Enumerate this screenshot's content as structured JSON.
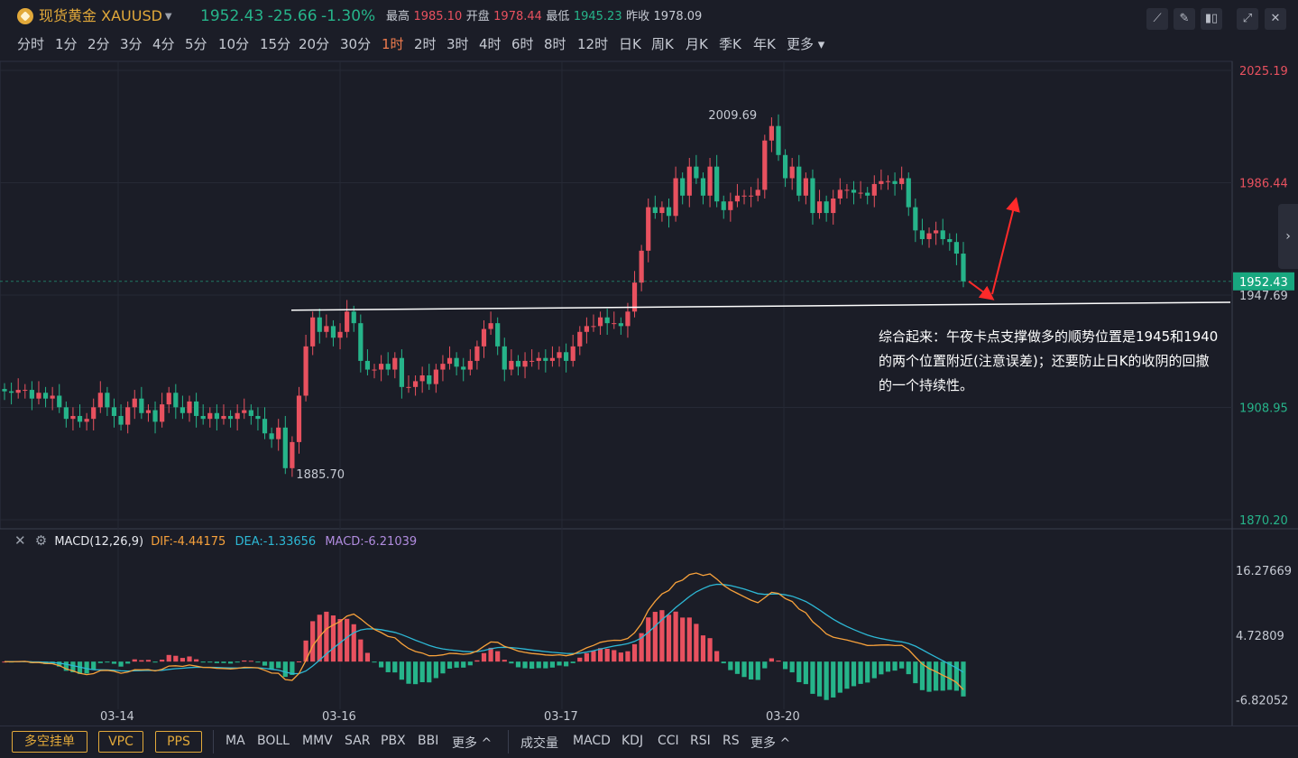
{
  "header": {
    "name": "现货黄金",
    "symbol": "XAUUSD",
    "price": "1952.43",
    "change": "-25.66",
    "change_pct": "-1.30%",
    "high_label": "最高",
    "high": "1985.10",
    "open_label": "开盘",
    "open": "1978.44",
    "low_label": "最低",
    "low": "1945.23",
    "prev_label": "昨收",
    "prev": "1978.09",
    "tools": [
      "line-tool-icon",
      "draw-pen-icon",
      "candle-style-icon",
      "fullscreen-icon",
      "close-icon"
    ]
  },
  "timeframes": [
    "分时",
    "1分",
    "2分",
    "3分",
    "4分",
    "5分",
    "10分",
    "15分",
    "20分",
    "30分",
    "1时",
    "2时",
    "3时",
    "4时",
    "6时",
    "8时",
    "12时",
    "日K",
    "周K",
    "月K",
    "季K",
    "年K",
    "更多"
  ],
  "active_timeframe": "1时",
  "colors": {
    "up": "#e8515f",
    "down": "#26b48a",
    "accent": "#e2a93a",
    "dif": "#f7a13b",
    "dea": "#2db8d5",
    "macd": "#b18cdf"
  },
  "chart_data": [
    {
      "type": "candlestick",
      "y_axis_labels": [
        "2025.19",
        "1986.44",
        "1947.69",
        "1908.95",
        "1870.20"
      ],
      "ylim": [
        1870.2,
        2025.19
      ],
      "x_axis_labels": [
        "03-14",
        "03-16",
        "03-17",
        "03-20"
      ],
      "last_price": "1952.43",
      "max_label": "2009.69",
      "min_label": "1885.70",
      "support_line": [
        1942.5,
        1945.2
      ],
      "grid": true,
      "closes": [
        1914.5,
        1914,
        1915,
        1915,
        1912,
        1914,
        1912,
        1913,
        1909,
        1905,
        1906,
        1904,
        1905,
        1909,
        1914,
        1909,
        1906,
        1903,
        1909,
        1912,
        1907,
        1908,
        1904,
        1910,
        1914,
        1909,
        1907,
        1911,
        1906,
        1905,
        1907,
        1905,
        1906,
        1905,
        1907,
        1908,
        1906,
        1905,
        1900,
        1898,
        1902,
        1888,
        1897,
        1913,
        1930,
        1940,
        1935,
        1937,
        1933,
        1935,
        1942,
        1938,
        1925,
        1922,
        1922,
        1924,
        1922,
        1926,
        1916,
        1916,
        1918,
        1920,
        1917,
        1922,
        1924,
        1926,
        1923,
        1922,
        1925,
        1930,
        1936,
        1938,
        1930,
        1922,
        1925,
        1923,
        1925,
        1925,
        1926,
        1925,
        1926,
        1928,
        1925,
        1930,
        1935,
        1937,
        1937,
        1940,
        1938,
        1938,
        1937,
        1942,
        1952,
        1963,
        1978,
        1976,
        1978,
        1975,
        1988,
        1982,
        1992,
        1988,
        1982,
        1992,
        1980,
        1977,
        1980,
        1982,
        1982,
        1982,
        1984,
        2001,
        2006,
        1996,
        1988,
        1992,
        1982,
        1988,
        1976,
        1980,
        1976,
        1981,
        1984,
        1984,
        1983,
        1983,
        1982,
        1986,
        1987,
        1987,
        1986,
        1988,
        1978,
        1970,
        1967,
        1969,
        1970,
        1967,
        1966,
        1962,
        1952.43
      ],
      "annotation_text": "综合起来：午夜卡点支撑做多的顺势位置是1945和1940的两个位置附近(注意误差)；还要防止日K的收阴的回撤的一个持续性。"
    },
    {
      "type": "macd",
      "title": "MACD(12,26,9)",
      "dif_label": "DIF:-4.44175",
      "dea_label": "DEA:-1.33656",
      "macd_label": "MACD:-6.21039",
      "y_axis_labels": [
        "16.27669",
        "4.72809",
        "-6.82052"
      ],
      "ylim": [
        -8.5,
        19.5
      ],
      "x_axis_labels": [
        "03-14",
        "03-16",
        "03-17",
        "03-20"
      ]
    }
  ],
  "macd_panel": {
    "title": "MACD(12,26,9)",
    "dif": "DIF:-4.44175",
    "dea": "DEA:-1.33656",
    "macd": "MACD:-6.21039"
  },
  "bottom_bar": {
    "buttons": [
      "多空挂单",
      "VPC",
      "PPS"
    ],
    "main_indicators": [
      "MA",
      "BOLL",
      "MMV",
      "SAR",
      "PBX",
      "BBI",
      "更多 ^"
    ],
    "sub_indicators": [
      "成交量",
      "MACD",
      "KDJ",
      "CCI",
      "RSI",
      "RS",
      "更多 ^"
    ]
  }
}
